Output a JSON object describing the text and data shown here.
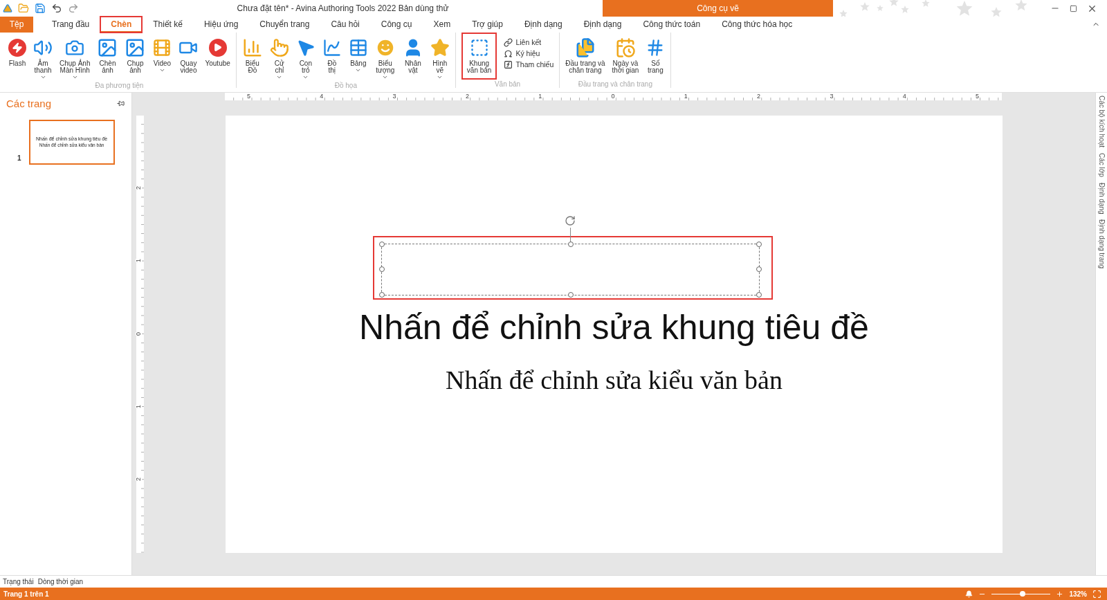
{
  "app_bar": {
    "title": "Chưa đặt tên* - Avina Authoring Tools 2022 Bản dùng thử",
    "context_header": "Công cụ vẽ"
  },
  "tabs": [
    {
      "label": "Tệp",
      "kind": "file",
      "selected": false,
      "highlighted": false
    },
    {
      "label": "Trang đầu",
      "kind": "tab",
      "selected": false,
      "highlighted": false
    },
    {
      "label": "Chèn",
      "kind": "tab",
      "selected": true,
      "highlighted": true
    },
    {
      "label": "Thiết kế",
      "kind": "tab",
      "selected": false,
      "highlighted": false
    },
    {
      "label": "Hiệu ứng",
      "kind": "tab",
      "selected": false,
      "highlighted": false
    },
    {
      "label": "Chuyển trang",
      "kind": "tab",
      "selected": false,
      "highlighted": false
    },
    {
      "label": "Câu hỏi",
      "kind": "tab",
      "selected": false,
      "highlighted": false
    },
    {
      "label": "Công cụ",
      "kind": "tab",
      "selected": false,
      "highlighted": false
    },
    {
      "label": "Xem",
      "kind": "tab",
      "selected": false,
      "highlighted": false
    },
    {
      "label": "Trợ giúp",
      "kind": "tab",
      "selected": false,
      "highlighted": false
    },
    {
      "label": "Định dạng",
      "kind": "tab",
      "selected": false,
      "highlighted": false
    },
    {
      "label": "Định dạng",
      "kind": "tab",
      "selected": false,
      "highlighted": false
    },
    {
      "label": "Công thức toán",
      "kind": "tab",
      "selected": false,
      "highlighted": false
    },
    {
      "label": "Công thức hóa học",
      "kind": "tab",
      "selected": false,
      "highlighted": false
    }
  ],
  "ribbon": {
    "groups": [
      {
        "label": "Đa phương tiện",
        "buttons": [
          {
            "kind": "flash",
            "label": "Flash",
            "dropdown": false,
            "highlighted": false
          },
          {
            "kind": "audio",
            "label": "Âm\nthanh",
            "dropdown": true,
            "highlighted": false
          },
          {
            "kind": "screenshot",
            "label": "Chụp Ảnh\nMàn Hình",
            "dropdown": true,
            "highlighted": false
          },
          {
            "kind": "image",
            "label": "Chèn\nảnh",
            "dropdown": false,
            "highlighted": false
          },
          {
            "kind": "camera-image",
            "label": "Chụp\nảnh",
            "dropdown": false,
            "highlighted": false
          },
          {
            "kind": "video",
            "label": "Video",
            "dropdown": true,
            "highlighted": false
          },
          {
            "kind": "record",
            "label": "Quay\nvideo",
            "dropdown": false,
            "highlighted": false
          },
          {
            "kind": "youtube",
            "label": "Youtube",
            "dropdown": false,
            "highlighted": false
          }
        ]
      },
      {
        "label": "Đồ họa",
        "buttons": [
          {
            "kind": "chart",
            "label": "Biểu\nĐồ",
            "dropdown": false,
            "highlighted": false
          },
          {
            "kind": "gesture",
            "label": "Cử\nchỉ",
            "dropdown": true,
            "highlighted": false
          },
          {
            "kind": "cursor",
            "label": "Con\ntrỏ",
            "dropdown": true,
            "highlighted": false
          },
          {
            "kind": "graph",
            "label": "Đồ\nthị",
            "dropdown": false,
            "highlighted": false
          },
          {
            "kind": "table",
            "label": "Bảng",
            "dropdown": true,
            "highlighted": false
          },
          {
            "kind": "emoji",
            "label": "Biểu\ntượng",
            "dropdown": true,
            "highlighted": false
          },
          {
            "kind": "character",
            "label": "Nhân\nvật",
            "dropdown": false,
            "highlighted": false
          },
          {
            "kind": "shape",
            "label": "Hình\nvẽ",
            "dropdown": true,
            "highlighted": false
          }
        ]
      },
      {
        "label": "Văn bản",
        "buttons": [
          {
            "kind": "textbox",
            "label": "Khung\nvăn bản",
            "dropdown": false,
            "highlighted": true
          }
        ],
        "small_buttons": [
          {
            "kind": "link",
            "label": "Liên kết"
          },
          {
            "kind": "symbol",
            "label": "Ký hiệu"
          },
          {
            "kind": "function",
            "label": "Tham chiếu"
          }
        ]
      },
      {
        "label": "Đầu trang và chân trang",
        "buttons": [
          {
            "kind": "header",
            "label": "Đầu trang và\nchân trang",
            "dropdown": false,
            "highlighted": false
          },
          {
            "kind": "date",
            "label": "Ngày và\nthời gian",
            "dropdown": false,
            "highlighted": false
          },
          {
            "kind": "page-number",
            "label": "Số\ntrang",
            "dropdown": false,
            "highlighted": false
          }
        ]
      }
    ]
  },
  "pages_panel": {
    "title": "Các trang",
    "pages": [
      {
        "number": "1",
        "selected": true,
        "title": "Nhấn để chỉnh sửa khung tiêu đề",
        "subtitle": "Nhấn để chỉnh sửa kiểu văn bản"
      }
    ]
  },
  "horizontal_ruler": [
    "5",
    "4",
    "3",
    "2",
    "1",
    "0",
    "1",
    "2",
    "3",
    "4",
    "5"
  ],
  "vertical_ruler": [
    "2",
    "1",
    "0",
    "1",
    "2"
  ],
  "slide": {
    "text_box": {
      "highlighted": true
    },
    "title": "Nhấn để chỉnh sửa khung tiêu đề",
    "subtitle": "Nhấn để chỉnh sửa kiểu văn bản"
  },
  "side_tabs": [
    "Các bộ kích hoạt",
    "Các lớp",
    "Định dạng",
    "Định dạng trang"
  ],
  "bottom_tabs": [
    "Trạng thái",
    "Dòng thời gian"
  ],
  "status_bar": {
    "page": "Trang 1 trên 1",
    "zoom": {
      "level": 0.53,
      "reading": "132%"
    }
  }
}
